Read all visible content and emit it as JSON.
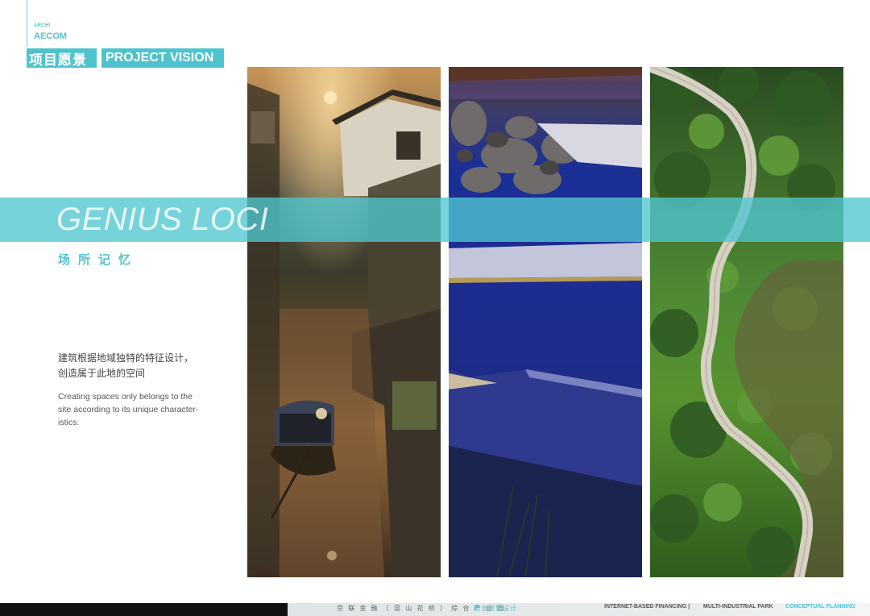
{
  "header": {
    "brand_small": "ARCHI",
    "brand": "AECOM",
    "tag_cn": "项目愿景",
    "tag_en": "PROJECT VISION"
  },
  "hero": {
    "title": "GENIUS LOCI",
    "subtitle_cn": "场所记忆"
  },
  "description": {
    "cn_lines": [
      "建筑根据地域独特的特征设计，",
      "创造属于此地的空间"
    ],
    "en_lines": [
      "Creating spaces only belongs to the",
      "site according to its unique character-",
      "istics."
    ]
  },
  "photos": [
    {
      "name": "water-town-canal-photo"
    },
    {
      "name": "night-water-feature-photo"
    },
    {
      "name": "garden-path-aerial-photo"
    }
  ],
  "footer": {
    "cn_text": "京 联 金 融 （ 昆 山 花 桥 ） 综 合 产 业 园",
    "cn_highlight": "概念规划设计",
    "en_1": "INTERNET-BASED FINANCING |",
    "en_2": "MULTI-INDUSTRIAL PARK",
    "en_highlight": "CONCEPTUAL PLANNING"
  },
  "colors": {
    "accent": "#4fc3cd",
    "footer_dark": "#111111"
  }
}
